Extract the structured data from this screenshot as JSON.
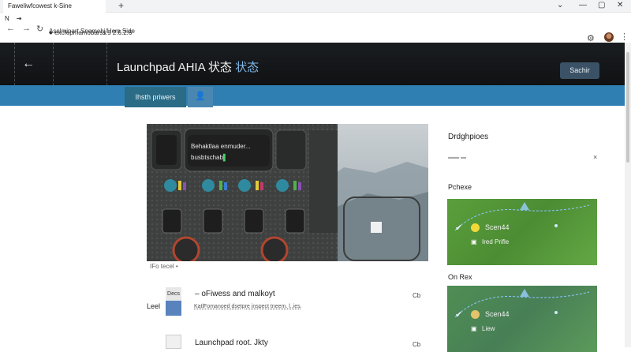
{
  "browser": {
    "tab_title": "Faweliwfcowest k-Sine",
    "bookmark_label": "Aselmipart Snemehj/Hem Side",
    "url": "excfepmamobarss.s 2.6.2.6",
    "tab_sidebar": [
      "N",
      "⇥"
    ]
  },
  "header": {
    "title": "Launchpad AHIA 状态",
    "title_accent": "状态",
    "search_label": "Sachir"
  },
  "tabs": {
    "active_label": "Ihsth priwers"
  },
  "media": {
    "panel_line1": "Behaktlaa enmuder...",
    "panel_line2": "busbtschab",
    "caption": "IFo tecel •"
  },
  "list": {
    "label": "Leel",
    "items": [
      {
        "box": "Decs",
        "title": "– oFiwess and malkoyt",
        "subtitle": "KatlFomanoed dsetpre inspect tneem. l..ies.",
        "meta": "Cb"
      },
      {
        "title": "Launchpad root. Jkty",
        "meta": "Cb"
      }
    ]
  },
  "sidebar": {
    "heading": "Drdghpioes",
    "sections": [
      {
        "label": "Pchexe",
        "name": "Scen44",
        "sub": "Ired Prifle"
      },
      {
        "label": "On Rex",
        "name": "Scen44",
        "sub": "Liew"
      }
    ]
  },
  "colors": {
    "header_bg": "#141618",
    "band": "#2f7fb3",
    "active_tab": "#2a6b86",
    "map_green": "#5a9f3c"
  }
}
